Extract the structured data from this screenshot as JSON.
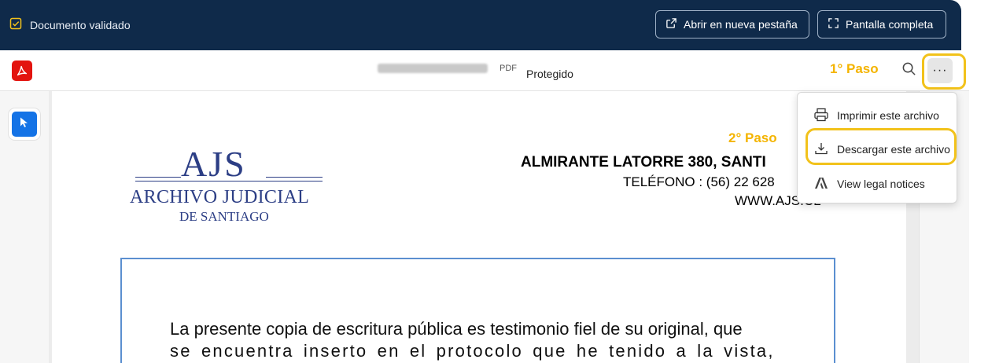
{
  "banner": {
    "status_text": "Documento validado",
    "open_new_tab_label": "Abrir en nueva pestaña",
    "fullscreen_label": "Pantalla completa",
    "background_color": "#0f2a4a"
  },
  "viewer": {
    "file_type": "PDF",
    "protection_status": "Protegido",
    "more_label": "···",
    "annotation_step1": "1° Paso",
    "annotation_step2": "2° Paso",
    "highlight_color": "#f2c21b"
  },
  "menu": {
    "items": [
      {
        "label": "Imprimir este archivo",
        "icon": "printer-icon"
      },
      {
        "label": "Descargar este archivo",
        "icon": "download-icon"
      },
      {
        "label": "View legal notices",
        "icon": "adobe-icon"
      }
    ]
  },
  "document": {
    "logo_abbr": "AJS",
    "logo_name": "ARCHIVO JUDICIAL",
    "logo_city": "DE SANTIAGO",
    "address": "ALMIRANTE LATORRE 380, SANTI",
    "phone": "TELÉFONO : (56) 22 628",
    "web": "WWW.AJS.CL",
    "body_line1": "La presente copia de escritura pública es testimonio fiel de su original, que",
    "body_line2": "se encuentra inserto en el protocolo que he tenido a la vista,"
  }
}
